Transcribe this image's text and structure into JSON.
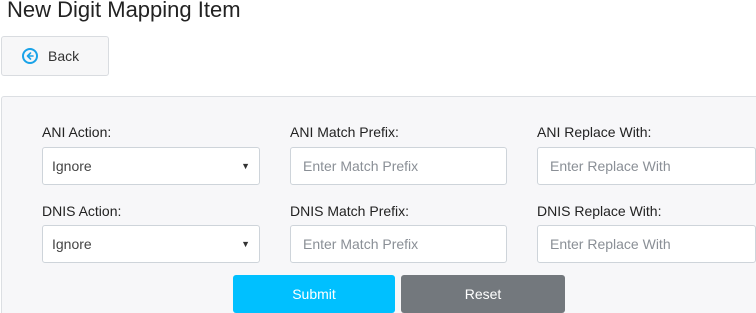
{
  "page": {
    "title": "New Digit Mapping Item"
  },
  "toolbar": {
    "back_label": "Back",
    "back_icon": "arrow-left-circle-icon"
  },
  "form": {
    "ani_action": {
      "label": "ANI Action:",
      "value": "Ignore"
    },
    "ani_match_prefix": {
      "label": "ANI Match Prefix:",
      "placeholder": "Enter Match Prefix",
      "value": ""
    },
    "ani_replace_with": {
      "label": "ANI Replace With:",
      "placeholder": "Enter Replace With",
      "value": ""
    },
    "dnis_action": {
      "label": "DNIS Action:",
      "value": "Ignore"
    },
    "dnis_match_prefix": {
      "label": "DNIS Match Prefix:",
      "placeholder": "Enter Match Prefix",
      "value": ""
    },
    "dnis_replace_with": {
      "label": "DNIS Replace With:",
      "placeholder": "Enter Replace With",
      "value": ""
    },
    "submit_label": "Submit",
    "reset_label": "Reset"
  },
  "colors": {
    "accent": "#1aa3e8",
    "submit": "#00c0ff",
    "reset": "#73787d",
    "panel": "#f7f7f9"
  }
}
